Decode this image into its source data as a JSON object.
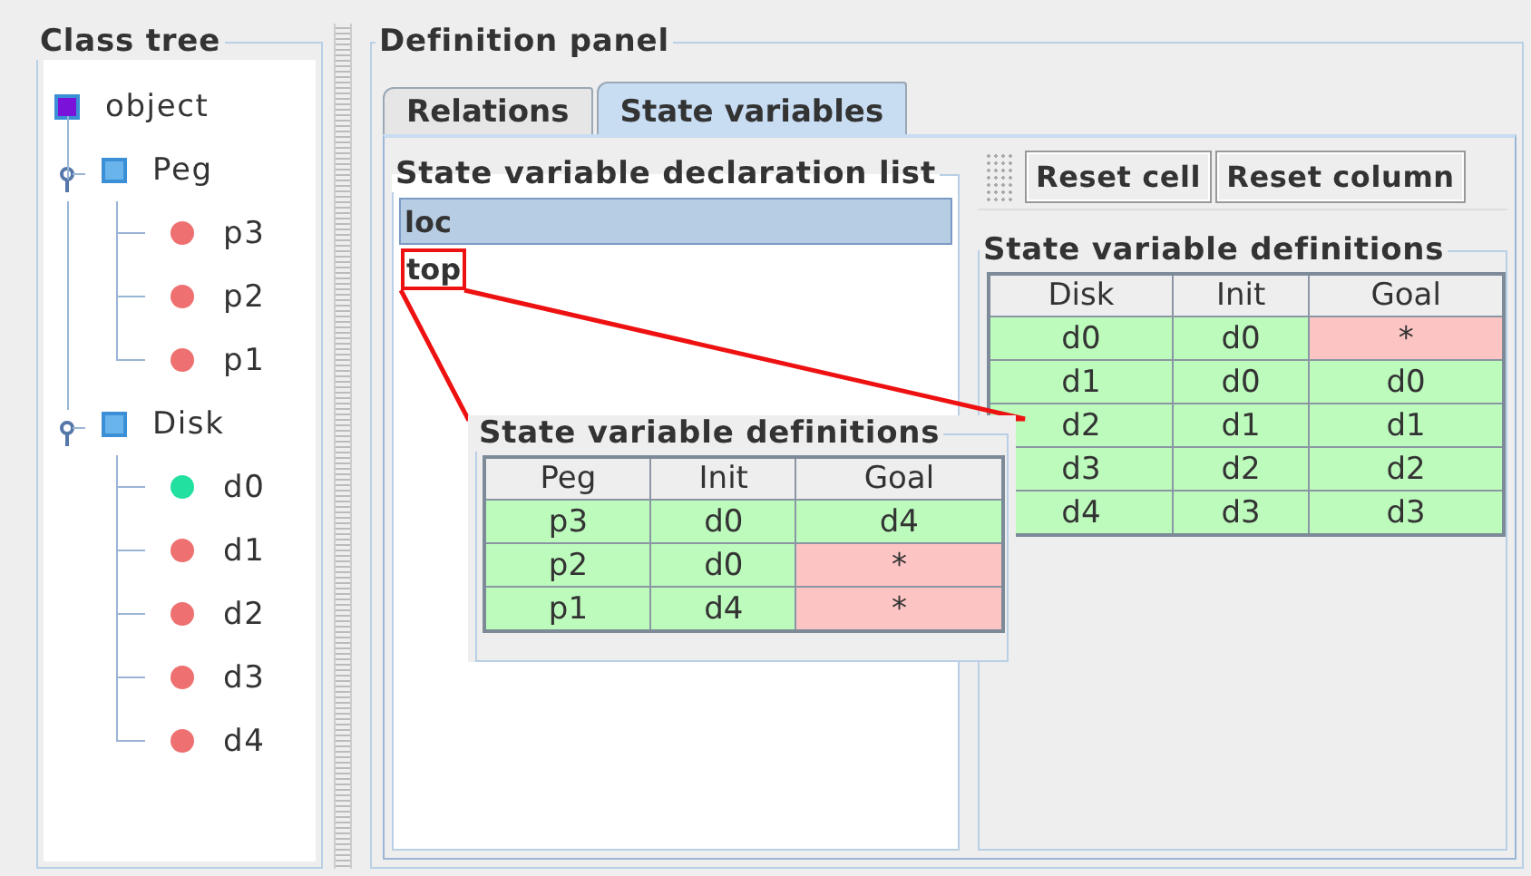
{
  "class_tree": {
    "title": "Class tree",
    "root": {
      "label": "object",
      "kind": "class",
      "color": "#7b12d9",
      "children": [
        {
          "label": "Peg",
          "kind": "class",
          "color": "#6ab4ec",
          "expanded": true,
          "children": [
            {
              "label": "p3",
              "kind": "instance",
              "color": "#ee7070"
            },
            {
              "label": "p2",
              "kind": "instance",
              "color": "#ee7070"
            },
            {
              "label": "p1",
              "kind": "instance",
              "color": "#ee7070"
            }
          ]
        },
        {
          "label": "Disk",
          "kind": "class",
          "color": "#6ab4ec",
          "expanded": true,
          "children": [
            {
              "label": "d0",
              "kind": "instance",
              "color": "#22e0a0"
            },
            {
              "label": "d1",
              "kind": "instance",
              "color": "#ee7070"
            },
            {
              "label": "d2",
              "kind": "instance",
              "color": "#ee7070"
            },
            {
              "label": "d3",
              "kind": "instance",
              "color": "#ee7070"
            },
            {
              "label": "d4",
              "kind": "instance",
              "color": "#ee7070"
            }
          ]
        }
      ]
    }
  },
  "definition_panel": {
    "title": "Definition panel",
    "tabs": [
      {
        "label": "Relations",
        "selected": false
      },
      {
        "label": "State variables",
        "selected": true
      }
    ],
    "declaration_list": {
      "title": "State variable declaration list",
      "items": [
        {
          "label": "loc",
          "selected": true,
          "highlighted": false
        },
        {
          "label": "top",
          "selected": false,
          "highlighted": true
        }
      ]
    },
    "toolbar": {
      "buttons": [
        "Reset cell",
        "Reset column"
      ]
    },
    "definitions": {
      "title": "State variable definitions",
      "columns": [
        "Disk",
        "Init",
        "Goal"
      ],
      "rows": [
        [
          {
            "text": "d0",
            "defined": true
          },
          {
            "text": "d0",
            "defined": true
          },
          {
            "text": "*",
            "defined": false
          }
        ],
        [
          {
            "text": "d1",
            "defined": true
          },
          {
            "text": "d0",
            "defined": true
          },
          {
            "text": "d0",
            "defined": true
          }
        ],
        [
          {
            "text": "d2",
            "defined": true
          },
          {
            "text": "d1",
            "defined": true
          },
          {
            "text": "d1",
            "defined": true
          }
        ],
        [
          {
            "text": "d3",
            "defined": true
          },
          {
            "text": "d2",
            "defined": true
          },
          {
            "text": "d2",
            "defined": true
          }
        ],
        [
          {
            "text": "d4",
            "defined": true
          },
          {
            "text": "d3",
            "defined": true
          },
          {
            "text": "d3",
            "defined": true
          }
        ]
      ]
    },
    "callout": {
      "title": "State variable definitions",
      "columns": [
        "Peg",
        "Init",
        "Goal"
      ],
      "rows": [
        [
          {
            "text": "p3",
            "defined": true
          },
          {
            "text": "d0",
            "defined": true
          },
          {
            "text": "d4",
            "defined": true
          }
        ],
        [
          {
            "text": "p2",
            "defined": true
          },
          {
            "text": "d0",
            "defined": true
          },
          {
            "text": "*",
            "defined": false
          }
        ],
        [
          {
            "text": "p1",
            "defined": true
          },
          {
            "text": "d4",
            "defined": true
          },
          {
            "text": "*",
            "defined": false
          }
        ]
      ]
    }
  }
}
